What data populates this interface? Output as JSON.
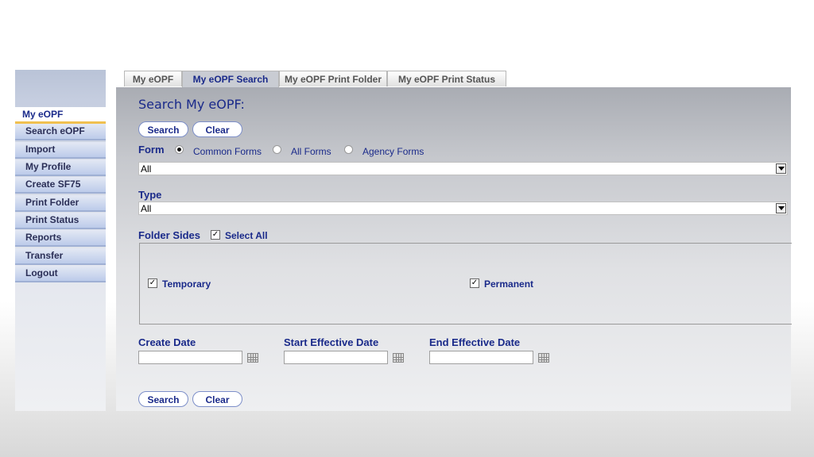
{
  "sidebar": {
    "title": "My eOPF",
    "items": [
      {
        "label": "Search eOPF"
      },
      {
        "label": "Import"
      },
      {
        "label": "My Profile"
      },
      {
        "label": "Create SF75"
      },
      {
        "label": "Print Folder"
      },
      {
        "label": "Print Status"
      },
      {
        "label": "Reports"
      },
      {
        "label": "Transfer"
      },
      {
        "label": "Logout"
      }
    ]
  },
  "tabs": [
    {
      "label": "My eOPF",
      "active": false
    },
    {
      "label": "My eOPF Search",
      "active": true
    },
    {
      "label": "My eOPF Print Folder",
      "active": false
    },
    {
      "label": "My eOPF Print Status",
      "active": false
    }
  ],
  "main": {
    "title": "Search My eOPF:",
    "search_label": "Search",
    "clear_label": "Clear",
    "form": {
      "label": "Form",
      "options": [
        "Common Forms",
        "All Forms",
        "Agency Forms"
      ],
      "selected": "Common Forms",
      "value": "All"
    },
    "type": {
      "label": "Type",
      "value": "All"
    },
    "folder_sides": {
      "label": "Folder Sides",
      "select_all_label": "Select All",
      "temporary_label": "Temporary",
      "permanent_label": "Permanent"
    },
    "dates": {
      "create_label": "Create Date",
      "start_label": "Start Effective Date",
      "end_label": "End Effective Date"
    }
  },
  "colors": {
    "accent": "#1a2a8a",
    "sidebar_highlight": "#f0c050"
  }
}
